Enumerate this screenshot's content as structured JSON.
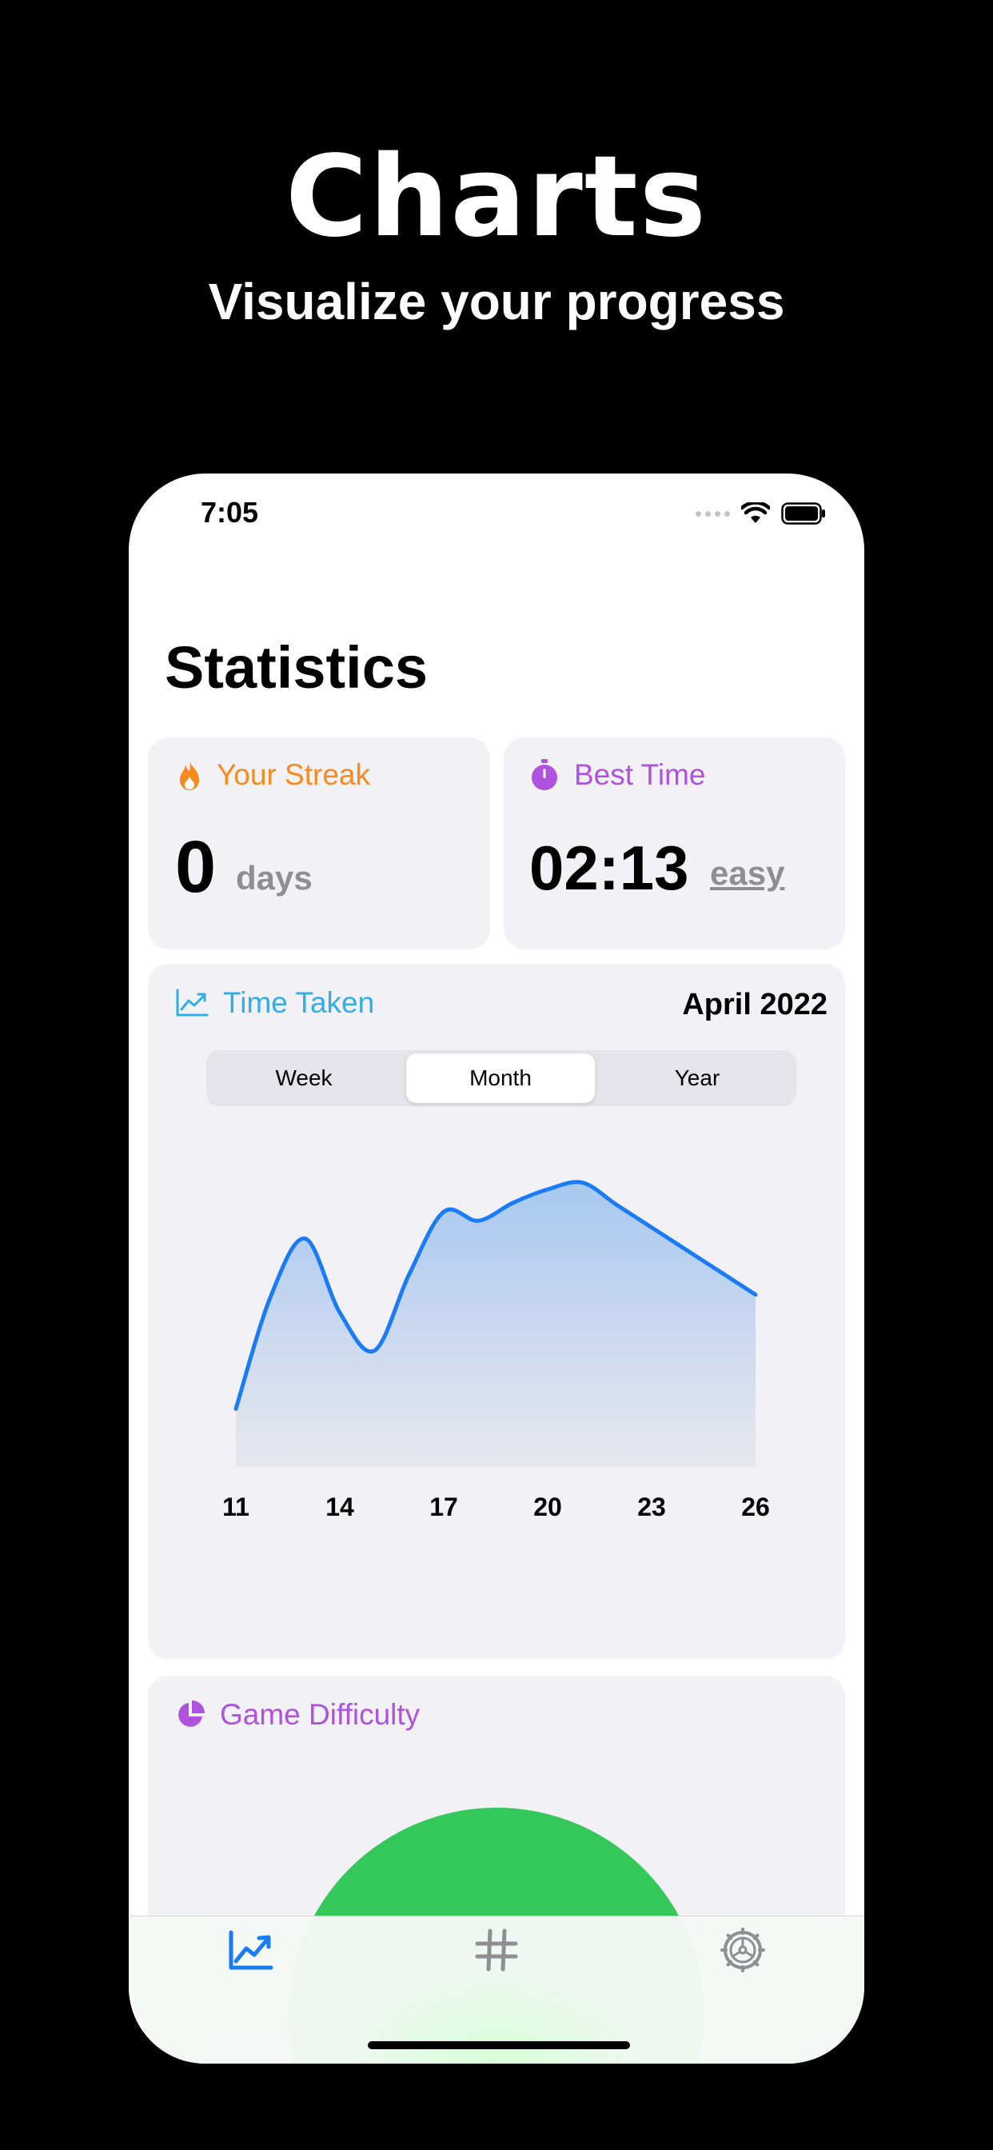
{
  "hero": {
    "title": "Charts",
    "subtitle": "Visualize your progress"
  },
  "status_bar": {
    "time": "7:05"
  },
  "page": {
    "title": "Statistics"
  },
  "streak_card": {
    "title": "Your Streak",
    "value": "0",
    "unit": "days",
    "icon": "flame-icon",
    "color": "#f68a1e"
  },
  "best_time_card": {
    "title": "Best Time",
    "value": "02:13",
    "unit": "easy",
    "icon": "stopwatch-icon",
    "color": "#af52de"
  },
  "time_taken_card": {
    "title": "Time Taken",
    "icon": "line-chart-icon",
    "color": "#32ade6",
    "period_label": "April 2022",
    "tabs": [
      "Week",
      "Month",
      "Year"
    ],
    "selected_tab": "Month"
  },
  "chart_data": {
    "type": "area",
    "x": [
      11,
      12,
      13,
      14,
      15,
      16,
      17,
      18,
      19,
      20,
      21,
      22,
      23,
      24,
      25,
      26
    ],
    "values": [
      12,
      62,
      88,
      55,
      38,
      72,
      100,
      96,
      104,
      110,
      113,
      103,
      93,
      83,
      73,
      63
    ],
    "x_ticks": [
      "11",
      "14",
      "17",
      "20",
      "23",
      "26"
    ],
    "line_color": "#1a7cf5",
    "grid": false,
    "y_range": [
      0,
      125
    ],
    "x_range": [
      11,
      26
    ]
  },
  "difficulty_card": {
    "title": "Game Difficulty",
    "icon": "pie-chart-icon",
    "color": "#af52de",
    "pie_color": "#34c759"
  },
  "tab_bar": {
    "items": [
      {
        "name": "statistics",
        "icon": "chart-trend-icon",
        "active": true
      },
      {
        "name": "game",
        "icon": "grid-hash-icon",
        "active": false
      },
      {
        "name": "settings",
        "icon": "settings-gear-icon",
        "active": false
      }
    ]
  }
}
